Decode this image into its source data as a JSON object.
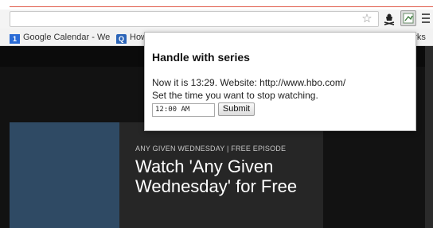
{
  "browser": {
    "bookmarks": [
      {
        "label": "Google Calendar - We",
        "icon": "calendar-icon",
        "icon_text": "1"
      },
      {
        "label": "How",
        "icon": "bookmark-icon",
        "icon_text": "Q"
      },
      {
        "label": "harks"
      }
    ],
    "icons": [
      "star-icon",
      "pirate-extension-icon",
      "extension-icon",
      "menu-icon"
    ]
  },
  "page": {
    "eyebrow": "ANY GIVEN WEDNESDAY | FREE EPISODE",
    "hero_title": "Watch 'Any Given Wednesday' for Free"
  },
  "popup": {
    "title": "Handle with series",
    "line1": "Now it is 13:29. Website: http://www.hbo.com/",
    "line2": "Set the time you want to stop watching.",
    "time_value": "12:00 AM",
    "submit_label": "Submit"
  },
  "colors": {
    "accent_line": "#e05a4a",
    "hero_blue": "#2f4a64"
  }
}
